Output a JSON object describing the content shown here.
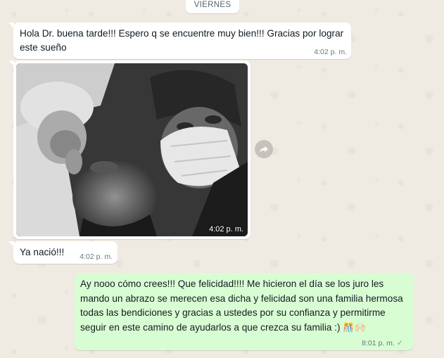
{
  "chat": {
    "day_label": "VIERNES",
    "messages": [
      {
        "direction": "incoming",
        "text": "Hola Dr. buena tarde!!! Espero q se encuentre muy bien!!! Gracias por lograr este sueño",
        "time": "4:02 p. m."
      },
      {
        "direction": "incoming",
        "type": "photo",
        "time": "4:02 p. m."
      },
      {
        "direction": "incoming",
        "text": "Ya nació!!!",
        "time": "4:02 p. m."
      },
      {
        "direction": "outgoing",
        "text": "Ay nooo cómo crees!!! Que felicidad!!!! Me hicieron el día se los juro les mando un abrazo se merecen esa dicha y felicidad son una familia hermosa todas las bendiciones y gracias a ustedes por su confianza y permitirme seguir en este camino de ayudarlos a que crezca su familia :)",
        "emojis": "🎊🙌🏻",
        "time": "8:01 p. m.",
        "status": "sent"
      }
    ]
  },
  "icons": {
    "forward": "forward-icon",
    "status_tick": "single-check-icon"
  },
  "colors": {
    "background": "#efeae2",
    "incoming_bubble": "#ffffff",
    "outgoing_bubble": "#d9fdd3",
    "timestamp": "#667781"
  }
}
